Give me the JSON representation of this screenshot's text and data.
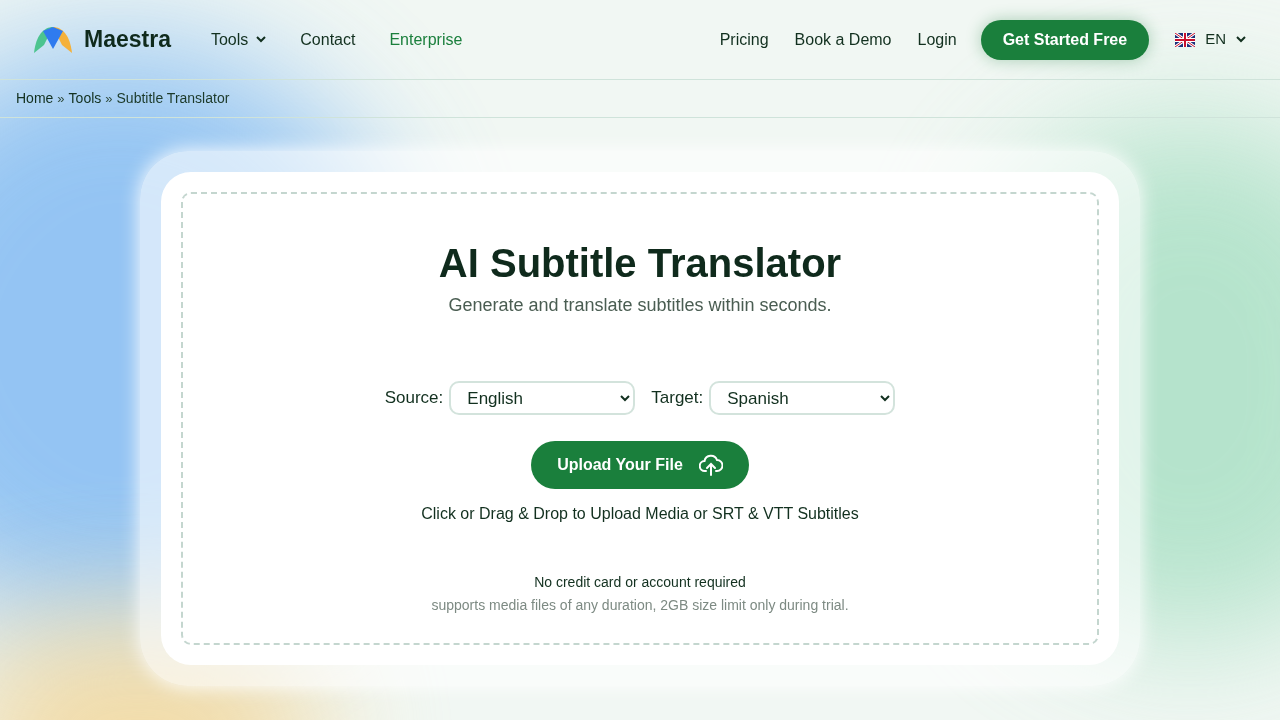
{
  "header": {
    "brand": "Maestra",
    "nav_left": [
      {
        "label": "Tools",
        "has_menu": true,
        "accent": false
      },
      {
        "label": "Contact",
        "has_menu": false,
        "accent": false
      },
      {
        "label": "Enterprise",
        "has_menu": false,
        "accent": true
      }
    ],
    "nav_right": [
      "Pricing",
      "Book a Demo",
      "Login"
    ],
    "cta": "Get Started Free",
    "language": "EN"
  },
  "breadcrumb": [
    {
      "kind": "link",
      "label": "Home"
    },
    {
      "kind": "separator",
      "label": "»"
    },
    {
      "kind": "link",
      "label": "Tools"
    },
    {
      "kind": "separator",
      "label": "»"
    },
    {
      "kind": "current",
      "label": "Subtitle Translator"
    }
  ],
  "tool": {
    "title": "AI Subtitle Translator",
    "subtitle": "Generate and translate subtitles within seconds.",
    "selects": [
      {
        "label": "Source:",
        "value": "English"
      },
      {
        "label": "Target:",
        "value": "Spanish"
      }
    ],
    "upload_button": "Upload Your File",
    "drop_hint": "Click or Drag & Drop to Upload Media or SRT & VTT Subtitles",
    "note": "No credit card or account required",
    "fine_print": "supports media files of any duration, 2GB size limit only during trial."
  }
}
